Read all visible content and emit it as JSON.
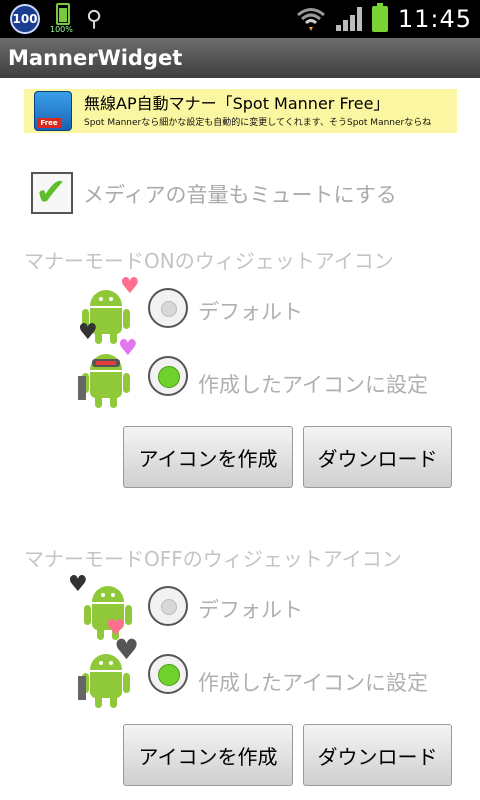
{
  "status_bar": {
    "badge": "100",
    "battery_small_label": "100%",
    "time": "11:45",
    "icons": [
      "notification-badge-icon",
      "battery-small-icon",
      "usb-icon",
      "wifi-icon",
      "signal-icon",
      "battery-icon"
    ],
    "colors": {
      "battery": "#7ad332",
      "background": "#000000"
    }
  },
  "app": {
    "title": "MannerWidget"
  },
  "ad": {
    "title": "無線AP自動マナー「Spot Manner Free」",
    "subtitle": "Spot Mannerなら細かな設定も自動的に変更してくれます、そうSpot Mannerならね",
    "icon_label": "Free"
  },
  "media_mute": {
    "label": "メディアの音量もミュートにする",
    "checked": true
  },
  "on_section": {
    "heading": "マナーモードONのウィジェットアイコン",
    "options": [
      {
        "label": "デフォルト",
        "selected": false
      },
      {
        "label": "作成したアイコンに設定",
        "selected": true
      }
    ],
    "create_button": "アイコンを作成",
    "download_button": "ダウンロード"
  },
  "off_section": {
    "heading": "マナーモードOFFのウィジェットアイコン",
    "options": [
      {
        "label": "デフォルト",
        "selected": false
      },
      {
        "label": "作成したアイコンに設定",
        "selected": true
      }
    ],
    "create_button": "アイコンを作成",
    "download_button": "ダウンロード"
  },
  "colors": {
    "accent_green": "#6fd12b",
    "disabled_text": "#b0b0b0",
    "ad_background": "#fbf6a1"
  }
}
